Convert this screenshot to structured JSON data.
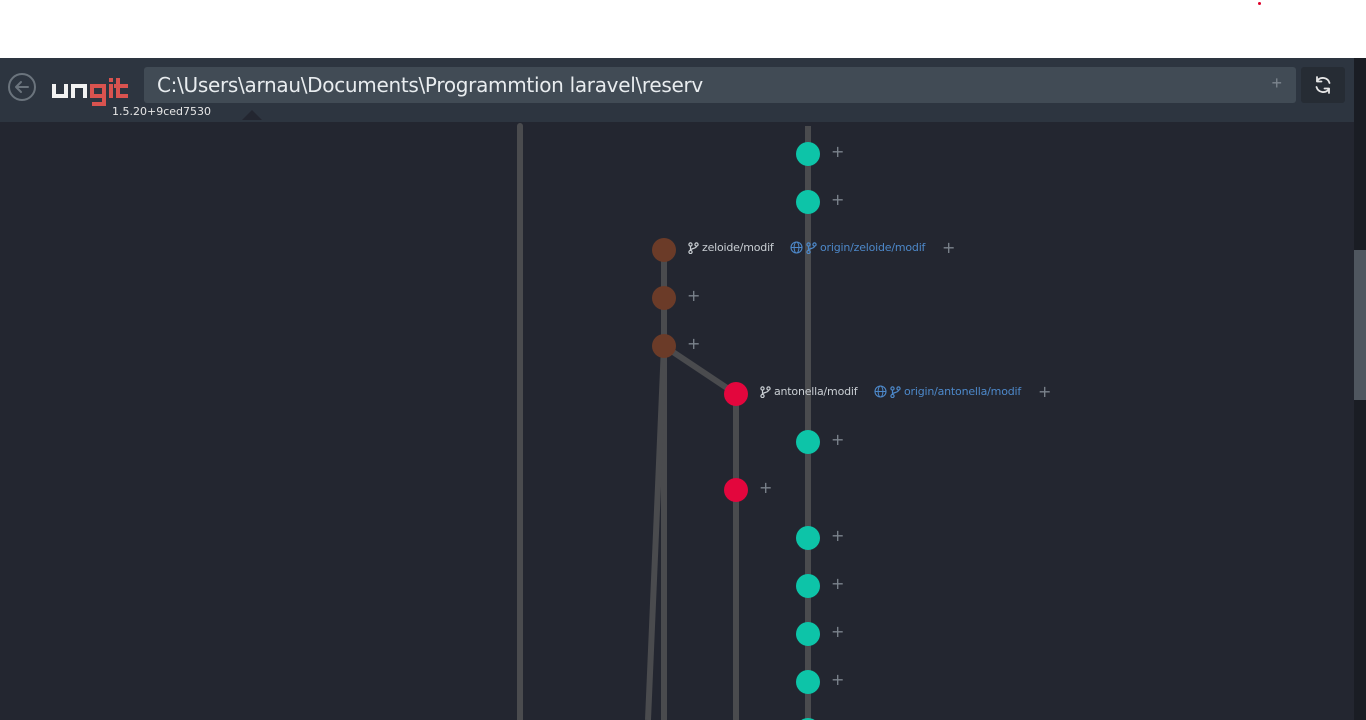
{
  "app": {
    "version": "1.5.20+9ced7530",
    "repo_path": "C:\\Users\\arnau\\Documents\\Programmtion laravel\\reserv",
    "path_add_label": "+",
    "logo_text": "ungit"
  },
  "graph": {
    "branches": [
      {
        "name": "zeloide/modif",
        "remote": "origin/zeloide/modif"
      },
      {
        "name": "antonella/modif",
        "remote": "origin/antonella/modif"
      }
    ],
    "plus_label": "+"
  },
  "colors": {
    "background": "#232630",
    "header": "#2d3540",
    "teal_node": "#0dc4a8",
    "brown_node": "#6b3b28",
    "red_node": "#e3063d",
    "line": "#4a4b4e",
    "remote_ref": "#4d88c9"
  },
  "icons": [
    "back-arrow-icon",
    "refresh-icon",
    "branch-icon",
    "globe-icon",
    "plus-icon"
  ]
}
